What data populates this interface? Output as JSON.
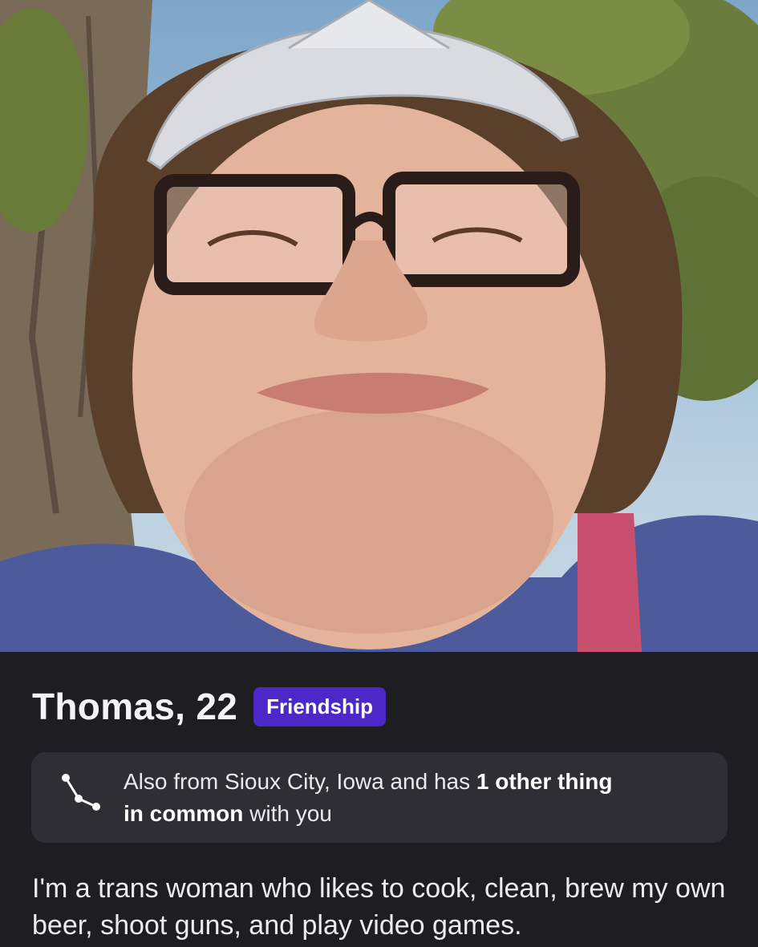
{
  "profile": {
    "name_age": "Thomas, 22",
    "badge": "Friendship",
    "photo_alt": "profile-photo"
  },
  "common": {
    "text_pre": "Also from Sioux City, Iowa and has ",
    "text_bold1": "1 other thing",
    "text_bold2": "in common",
    "text_post": " with you",
    "icon": "constellation-icon"
  },
  "bio": {
    "text": "I'm a trans woman who likes to cook, clean, brew my own beer, shoot guns, and play video games."
  },
  "colors": {
    "background": "#1e1e22",
    "card": "#2e2e34",
    "badge": "#4c28c8",
    "text": "#f2f2f4"
  }
}
